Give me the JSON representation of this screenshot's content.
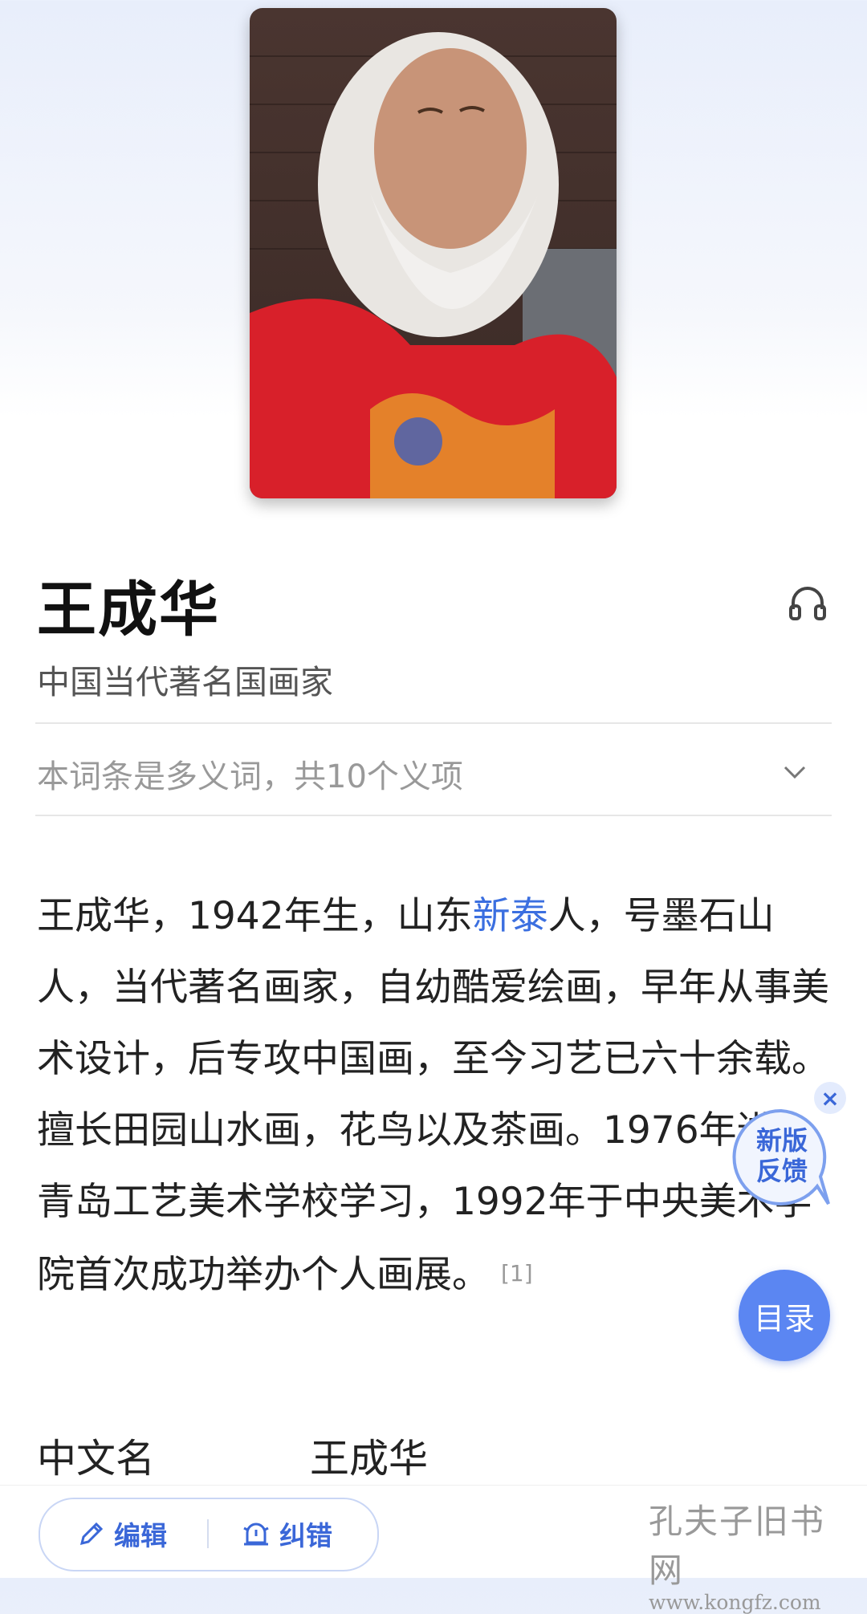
{
  "entry": {
    "title": "王成华",
    "subtitle": "中国当代著名国画家",
    "polysemy_note": "本词条是多义词，共10个义项"
  },
  "summary": {
    "part1": "王成华，1942年生，山东",
    "link": "新泰",
    "part2": "人，号墨石山人，当代著名画家，自幼酷爱绘画，早年从事美术设计，后专攻中国画，至今习艺已六十余载。擅长田园山水画，花鸟以及茶画。1976年进入青岛工艺美术学校学习，1992年于中央美术学院首次成功举办个人画展。",
    "citation": "[1]"
  },
  "basic_info": [
    {
      "label": "中文名",
      "value": "王成华"
    }
  ],
  "floating": {
    "feedback_close": "×",
    "feedback_line1": "新版",
    "feedback_line2": "反馈",
    "toc_label": "目录"
  },
  "bottom_bar": {
    "edit_label": "编辑",
    "report_label": "纠错"
  },
  "watermark": {
    "text": "孔夫子旧书网",
    "url": "www.kongfz.com"
  },
  "icons": [
    "headphone-icon",
    "chevron-down-icon",
    "pencil-icon",
    "report-icon"
  ],
  "colors": {
    "link": "#3b6fe0",
    "accent": "#3a67d8",
    "toc_button": "#5b86f2"
  }
}
